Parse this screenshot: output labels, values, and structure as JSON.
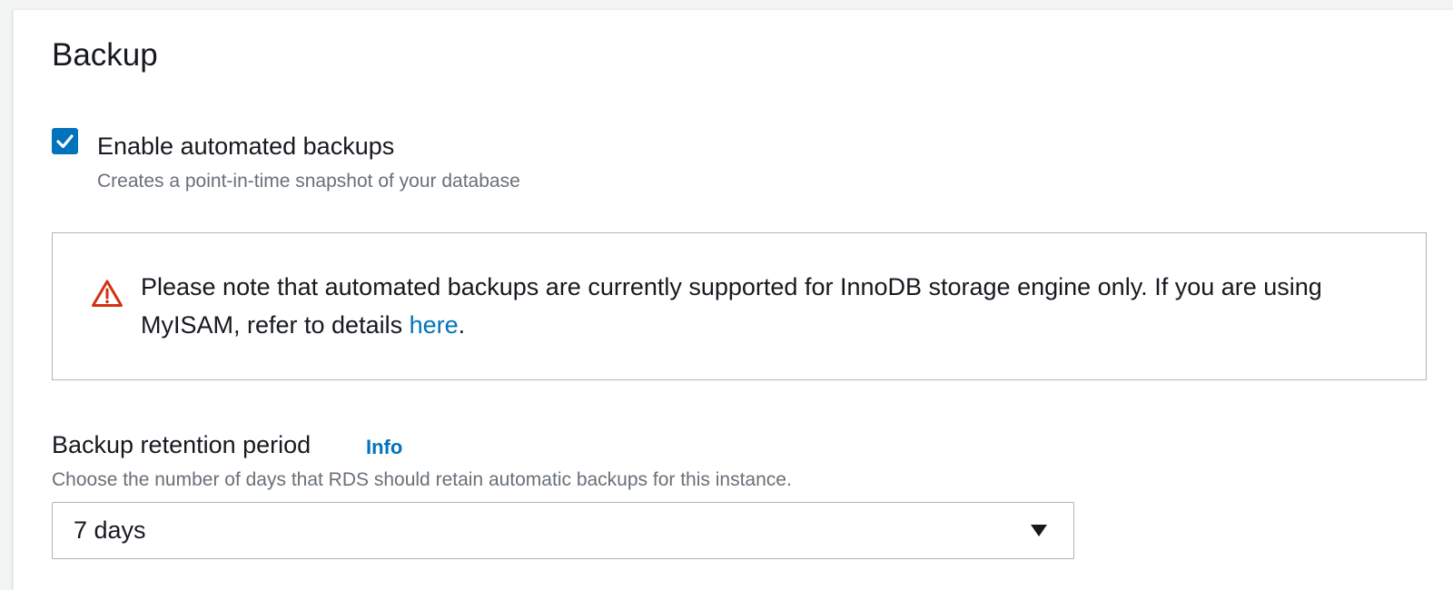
{
  "section": {
    "title": "Backup"
  },
  "automated_backups": {
    "label": "Enable automated backups",
    "description": "Creates a point-in-time snapshot of your database",
    "checked": true
  },
  "alert": {
    "text_before_link": "Please note that automated backups are currently supported for InnoDB storage engine only. If you are using MyISAM, refer to details ",
    "link_text": "here",
    "text_after_link": "."
  },
  "retention": {
    "label": "Backup retention period",
    "info_link": "Info",
    "description": "Choose the number of days that RDS should retain automatic backups for this instance.",
    "selected_value": "7 days"
  },
  "colors": {
    "accent": "#0073bb",
    "warning": "#d13212",
    "muted_text": "#687078",
    "border": "#aab7b8"
  },
  "icons": {
    "checkbox": "checkmark-icon",
    "alert": "warning-triangle-icon",
    "select": "caret-down-icon"
  }
}
